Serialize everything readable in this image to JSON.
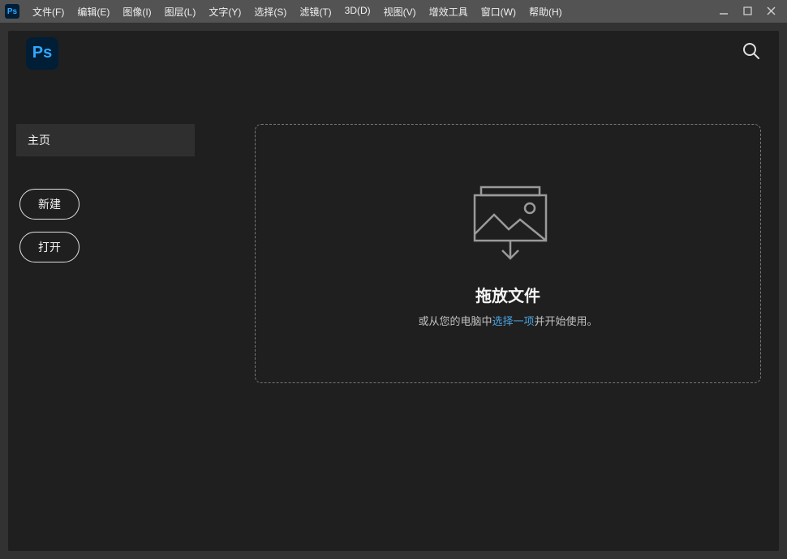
{
  "app_icon_text": "Ps",
  "menus": {
    "file": "文件(F)",
    "edit": "编辑(E)",
    "image": "图像(I)",
    "layer": "图层(L)",
    "type": "文字(Y)",
    "select": "选择(S)",
    "filter": "滤镜(T)",
    "threeD": "3D(D)",
    "view": "视图(V)",
    "plugins": "增效工具",
    "window": "窗口(W)",
    "help": "帮助(H)"
  },
  "logo_text": "Ps",
  "sidebar": {
    "home_tab": "主页",
    "new_button": "新建",
    "open_button": "打开"
  },
  "dropzone": {
    "title": "拖放文件",
    "sub_prefix": "或从您的电脑中",
    "link": "选择一项",
    "sub_suffix": "并开始使用。"
  }
}
